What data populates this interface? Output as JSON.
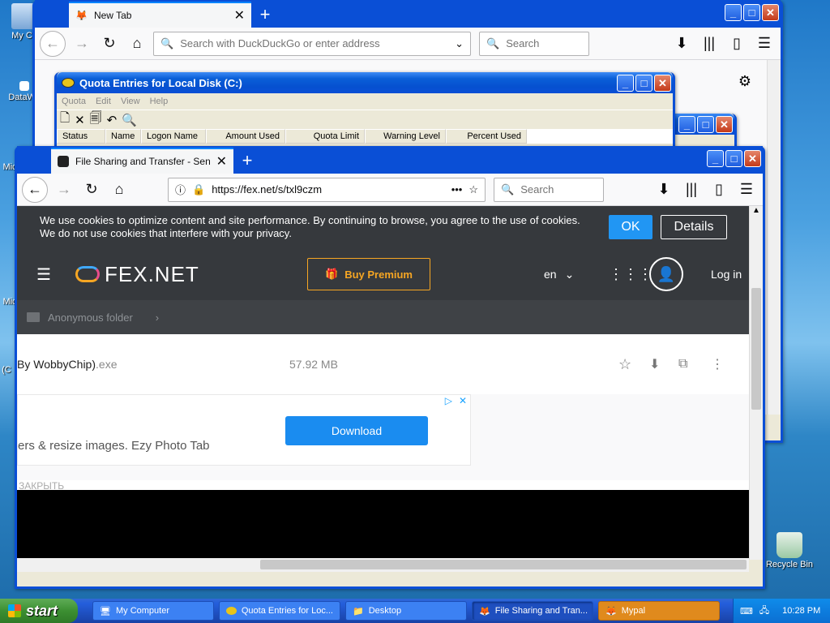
{
  "desktop": {
    "icons": [
      {
        "label": "My Co"
      },
      {
        "label": "DataWa"
      },
      {
        "label": "Mic"
      },
      {
        "label": "Mic"
      },
      {
        "label": "Wi (C"
      },
      {
        "label": "Recycle Bin"
      }
    ]
  },
  "bg_firefox": {
    "tab_title": "New Tab",
    "url_placeholder": "Search with DuckDuckGo or enter address",
    "search_placeholder": "Search"
  },
  "quota": {
    "title": "Quota Entries for Local Disk (C:)",
    "menu": [
      "Quota",
      "Edit",
      "View",
      "Help"
    ],
    "columns": [
      "Status",
      "Name",
      "Logon Name",
      "Amount Used",
      "Quota Limit",
      "Warning Level",
      "Percent Used"
    ]
  },
  "fex_firefox": {
    "tab_title": "File Sharing and Transfer - Send La",
    "url": "https://fex.net/s/txl9czm",
    "search_placeholder": "Search",
    "cookie_text": "We use cookies to optimize content and site performance. By continuing to browse, you agree to the use of cookies. We do not use cookies that interfere with your privacy.",
    "cookie_ok": "OK",
    "cookie_details": "Details",
    "brand": "FEX.NET",
    "buy_premium": "Buy Premium",
    "language": "en",
    "login": "Log in",
    "breadcrumb": "Anonymous folder",
    "file_name": "By WobbyChip)",
    "file_ext": ".exe",
    "file_size": "57.92 MB",
    "ad_download": "Download",
    "ad_text": "ers & resize images. Ezy Photo Tab",
    "close_text": "ЗАКРЫТЬ"
  },
  "taskbar": {
    "start": "start",
    "tasks": [
      {
        "label": "My Computer"
      },
      {
        "label": "Quota Entries for Loc..."
      },
      {
        "label": "Desktop"
      },
      {
        "label": "File Sharing and Tran..."
      },
      {
        "label": "Mypal"
      }
    ],
    "clock": "10:28 PM"
  }
}
